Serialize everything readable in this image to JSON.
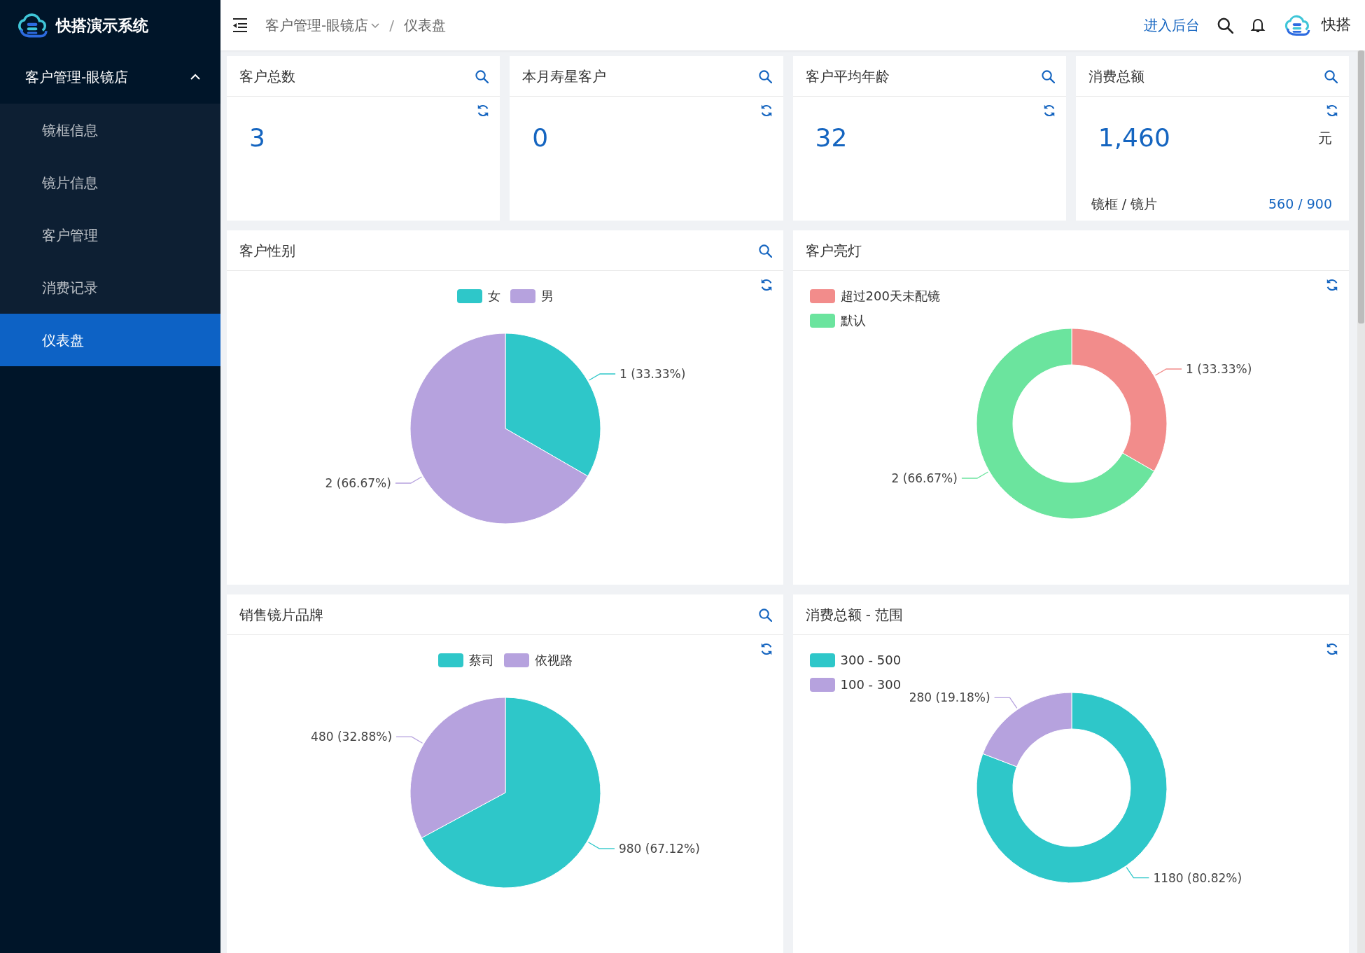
{
  "sidebar": {
    "logo_text": "快搭演示系统",
    "menu": [
      {
        "label": "客户管理-眼镜店",
        "expanded": true,
        "children": [
          {
            "label": "镜框信息",
            "selected": false
          },
          {
            "label": "镜片信息",
            "selected": false
          },
          {
            "label": "客户管理",
            "selected": false
          },
          {
            "label": "消费记录",
            "selected": false
          },
          {
            "label": "仪表盘",
            "selected": true
          }
        ]
      }
    ]
  },
  "topbar": {
    "breadcrumb": [
      {
        "label": "客户管理-眼镜店",
        "dropdown": true
      },
      {
        "label": "仪表盘",
        "dropdown": false
      }
    ],
    "separator": "/",
    "admin_link": "进入后台",
    "user_name": "快搭"
  },
  "stats": [
    {
      "title": "客户总数",
      "value": "3"
    },
    {
      "title": "本月寿星客户",
      "value": "0"
    },
    {
      "title": "客户平均年龄",
      "value": "32"
    },
    {
      "title": "消费总额",
      "value": "1,460",
      "unit": "元",
      "footer_label": "镜框 / 镜片",
      "footer_value": "560 / 900"
    }
  ],
  "charts": [
    {
      "title": "客户性别",
      "search": true,
      "legend": [
        {
          "color": "#2ec7c9"
        },
        {
          "color": "#b6a2de"
        }
      ],
      "chart_data": {
        "type": "pie",
        "categories": [
          "女",
          "男"
        ],
        "values": [
          1,
          2
        ],
        "value_labels": [
          "1 (33.33%)",
          "2 (66.67%)"
        ]
      }
    },
    {
      "title": "客户亮灯",
      "search": false,
      "legend": [
        {
          "color": "#f28c8b"
        },
        {
          "color": "#6be49e"
        }
      ],
      "chart_data": {
        "type": "donut",
        "categories": [
          "超过200天未配镜",
          "默认"
        ],
        "values": [
          1,
          2
        ],
        "value_labels": [
          "1 (33.33%)",
          "2 (66.67%)"
        ]
      }
    },
    {
      "title": "销售镜片品牌",
      "search": true,
      "legend": [
        {
          "color": "#2ec7c9"
        },
        {
          "color": "#b6a2de"
        }
      ],
      "chart_data": {
        "type": "pie",
        "categories": [
          "蔡司",
          "依视路"
        ],
        "values": [
          980,
          480
        ],
        "value_labels": [
          "980 (67.12%)",
          "480 (32.88%)"
        ]
      }
    },
    {
      "title": "消费总额 - 范围",
      "search": false,
      "legend": [
        {
          "color": "#2ec7c9"
        },
        {
          "color": "#b6a2de"
        }
      ],
      "chart_data": {
        "type": "donut",
        "categories": [
          "300 - 500",
          "100 - 300"
        ],
        "values": [
          1180,
          280
        ],
        "value_labels": [
          "1180 (80.82%)",
          "280 (19.18%)"
        ]
      }
    }
  ]
}
